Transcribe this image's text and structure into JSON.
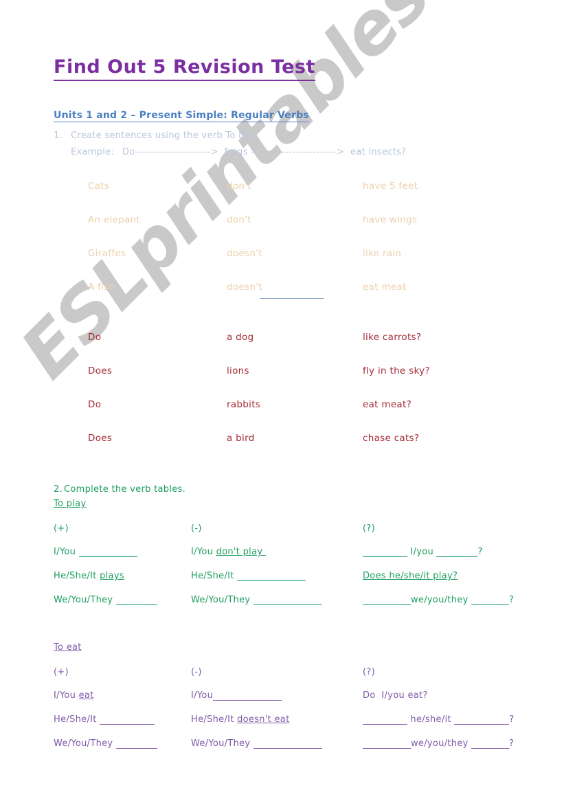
{
  "document": {
    "title": "Find Out 5 Revision Test",
    "units_heading": "Units 1 and 2 – Present Simple: Regular Verbs",
    "watermark": "ESLprintables.com"
  },
  "colors": {
    "title_purple": "#7b2fa0",
    "heading_blue": "#4a7fc1",
    "instruction_pale_blue": "#b9c6dd",
    "table1_tan": "#ecd0ab",
    "table2_red": "#a52a35",
    "table_green": "#1e9e61",
    "table_violet": "#7f5aa8",
    "separator_blue": "#8fa8c8",
    "watermark_grey": "#c9c9c9",
    "page_background": "#ffffff"
  },
  "exercise1": {
    "number": "1.",
    "instruction": "Create sentences using the verb To Do.",
    "example_label": "Example:",
    "example_body": "Do---------------------->  frogs ------------------------->  eat insects?",
    "statements": [
      {
        "subject": "Cats",
        "aux": "don't",
        "predicate": "have 5 feet"
      },
      {
        "subject": "An elepant",
        "aux": "don't",
        "predicate": "have wings"
      },
      {
        "subject": "Giraffes",
        "aux": "doesn't",
        "predicate": "like rain"
      },
      {
        "subject": "A fish",
        "aux": "doesn't",
        "predicate": "eat meat"
      }
    ],
    "questions": [
      {
        "aux": "Do",
        "subject": "a dog",
        "predicate": "like carrots?"
      },
      {
        "aux": "Does",
        "subject": "lions",
        "predicate": "fly in the sky?"
      },
      {
        "aux": "Do",
        "subject": "rabbits",
        "predicate": "eat meat?"
      },
      {
        "aux": "Does",
        "subject": "a bird",
        "predicate": "chase cats?"
      }
    ]
  },
  "exercise2": {
    "number": "2.",
    "instruction": "Complete the verb tables.",
    "tables": [
      {
        "verb_title": "To play",
        "color_key": "green",
        "headers": {
          "positive": "(+)",
          "negative": "(-)",
          "question": "(?)"
        },
        "rows": [
          {
            "pos_pre": "I/You ",
            "pos_answer": "",
            "pos_blank": "b85",
            "neg_pre": "I/You ",
            "neg_answer": "don't play",
            "neg_blank": "",
            "q_lead_blank": "b65",
            "q_mid": " I/you ",
            "q_answer": "",
            "q_tail_blank": "b60",
            "q_mark": "?"
          },
          {
            "pos_pre": "He/She/It ",
            "pos_answer": "plays",
            "pos_blank": "",
            "neg_pre": "He/She/It ",
            "neg_answer": "",
            "neg_blank": "b100",
            "q_lead_blank": "",
            "q_mid": "Does he/she/it play?",
            "q_answer": "",
            "q_tail_blank": "",
            "q_mark": ""
          },
          {
            "pos_pre": "We/You/They ",
            "pos_answer": "",
            "pos_blank": "b60",
            "neg_pre": "We/You/They ",
            "neg_answer": "",
            "neg_blank": "b100",
            "q_lead_blank": "b70",
            "q_mid": "we/you/they ",
            "q_answer": "",
            "q_tail_blank": "b55",
            "q_mark": "?"
          }
        ]
      },
      {
        "verb_title": "To eat",
        "color_key": "violet",
        "headers": {
          "positive": "(+)",
          "negative": "(-)",
          "question": "(?)"
        },
        "rows": [
          {
            "pos_pre": "I/You ",
            "pos_answer": "eat",
            "pos_blank": "",
            "neg_pre": "I/You",
            "neg_answer": "",
            "neg_blank": "b100",
            "q_lead_blank": "",
            "q_mid": "Do  I/you eat?",
            "q_answer": "",
            "q_tail_blank": "",
            "q_mark": ""
          },
          {
            "pos_pre": "He/She/It ",
            "pos_answer": "",
            "pos_blank": "b80",
            "neg_pre": "He/She/It ",
            "neg_answer": "doesn't eat",
            "neg_blank": "",
            "q_lead_blank": "b65",
            "q_mid": " he/she/it ",
            "q_answer": "",
            "q_tail_blank": "b80",
            "q_mark": "?"
          },
          {
            "pos_pre": "We/You/They ",
            "pos_answer": "",
            "pos_blank": "b60",
            "neg_pre": "We/You/They ",
            "neg_answer": "",
            "neg_blank": "b100",
            "q_lead_blank": "b70",
            "q_mid": "we/you/they ",
            "q_answer": "",
            "q_tail_blank": "b55",
            "q_mark": "?"
          }
        ]
      }
    ]
  }
}
